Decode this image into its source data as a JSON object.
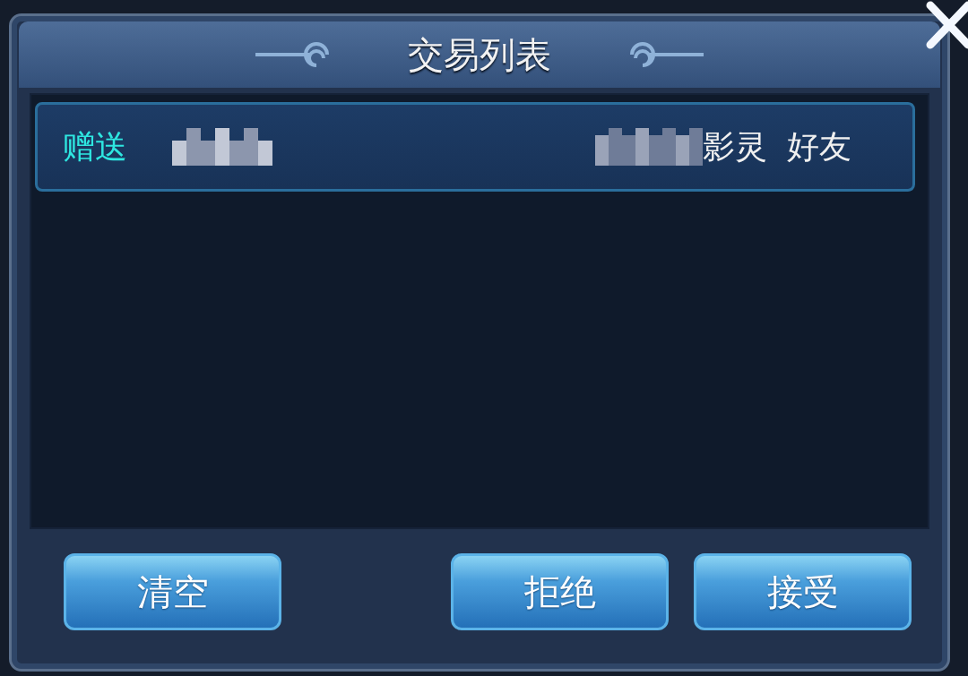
{
  "dialog": {
    "title": "交易列表"
  },
  "trades": [
    {
      "type": "赠送",
      "column_3": "影灵",
      "column_4": "好友",
      "selected": true
    }
  ],
  "buttons": [
    {
      "label": "清空"
    },
    {
      "label": "拒绝"
    },
    {
      "label": "接受"
    }
  ]
}
